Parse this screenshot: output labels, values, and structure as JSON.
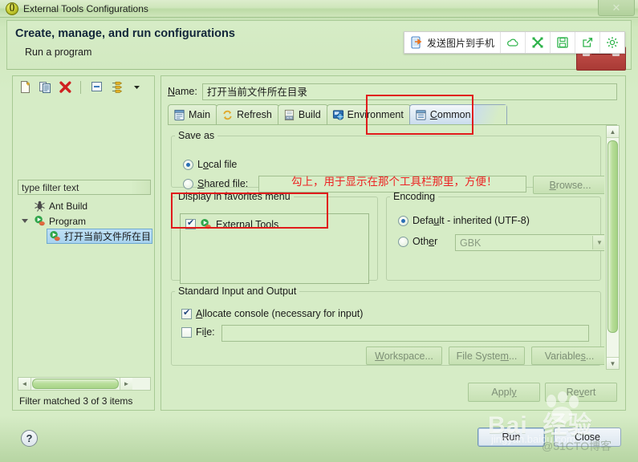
{
  "window": {
    "title": "External Tools Configurations",
    "icon": "eclipse-external-tools-icon",
    "close_label": "✕"
  },
  "header": {
    "title": "Create, manage, and run configurations",
    "subtitle": "Run a program"
  },
  "capture_toolbar": {
    "send_label": "发送图片到手机",
    "items": [
      {
        "name": "send-to-phone-icon",
        "label": "发送图片到手机"
      },
      {
        "name": "cloud-upload-icon",
        "label": ""
      },
      {
        "name": "expand-icon",
        "label": ""
      },
      {
        "name": "save-icon",
        "label": ""
      },
      {
        "name": "share-icon",
        "label": ""
      },
      {
        "name": "settings-gear-icon",
        "label": ""
      }
    ]
  },
  "left_panel": {
    "toolbar": [
      {
        "name": "new-configuration-icon"
      },
      {
        "name": "duplicate-configuration-icon"
      },
      {
        "name": "delete-configuration-icon"
      },
      {
        "name": "collapse-all-icon"
      },
      {
        "name": "filter-icon"
      },
      {
        "name": "view-menu-chevron-icon"
      }
    ],
    "filter_placeholder": "type filter text",
    "filter_value": "type filter text",
    "tree": [
      {
        "label": "Ant Build",
        "level": 0,
        "icon": "ant-build-icon",
        "selected": false,
        "expandable": false
      },
      {
        "label": "Program",
        "level": 0,
        "icon": "program-icon",
        "selected": false,
        "expandable": true,
        "expanded": true
      },
      {
        "label": "打开当前文件所在目",
        "level": 1,
        "icon": "program-icon",
        "selected": true,
        "expandable": false
      }
    ],
    "status": "Filter matched 3 of 3 items",
    "hscroll_left": "◄",
    "hscroll_right": "►"
  },
  "config": {
    "name_label": "Name:",
    "name_value": "打开当前文件所在目录",
    "tabs": [
      {
        "label": "Main",
        "icon": "main-tab-icon",
        "active": false
      },
      {
        "label": "Refresh",
        "icon": "refresh-tab-icon",
        "active": false
      },
      {
        "label": "Build",
        "icon": "build-tab-icon",
        "active": false
      },
      {
        "label": "Environment",
        "icon": "environment-tab-icon",
        "active": false
      },
      {
        "label": "Common",
        "icon": "common-tab-icon",
        "active": true
      }
    ],
    "save_as": {
      "legend": "Save as",
      "local_file_label": "Local file",
      "local_file_checked": true,
      "shared_file_label": "Shared file:",
      "shared_file_checked": false,
      "shared_file_value": "",
      "browse_label": "Browse..."
    },
    "favorites": {
      "legend": "Display in favorites menu",
      "items": [
        {
          "label": "External Tools",
          "checked": true,
          "icon": "external-tools-icon"
        }
      ]
    },
    "encoding": {
      "legend": "Encoding",
      "default_label": "Default - inherited (UTF-8)",
      "default_checked": true,
      "other_label": "Other",
      "other_checked": false,
      "other_value": "GBK",
      "dropdown_arrow": "▼"
    },
    "stdio": {
      "legend": "Standard Input and Output",
      "allocate_console_label": "Allocate console (necessary for input)",
      "allocate_console_checked": true,
      "file_label": "File:",
      "file_checked": false,
      "file_value": "",
      "workspace_label": "Workspace...",
      "file_system_label": "File System...",
      "variables_label": "Variables..."
    },
    "apply_label": "Apply",
    "revert_label": "Revert"
  },
  "footer": {
    "help_label": "?",
    "run_label": "Run",
    "close_label": "Close"
  },
  "annotations": {
    "note_text": "勾上，用于显示在那个工具栏那里，方便！",
    "note_color": "#ec2222",
    "box_color": "#e01b1b"
  },
  "watermark": {
    "baidu": "Bai",
    "baidu2": "du",
    "jingyan": "经验",
    "url": "jingyan.baidu.com",
    "cto": "@51CTO博客"
  },
  "scrollbars": {
    "up_arrow": "▲",
    "down_arrow": "▼",
    "left_arrow": "◄",
    "right_arrow": "►"
  }
}
